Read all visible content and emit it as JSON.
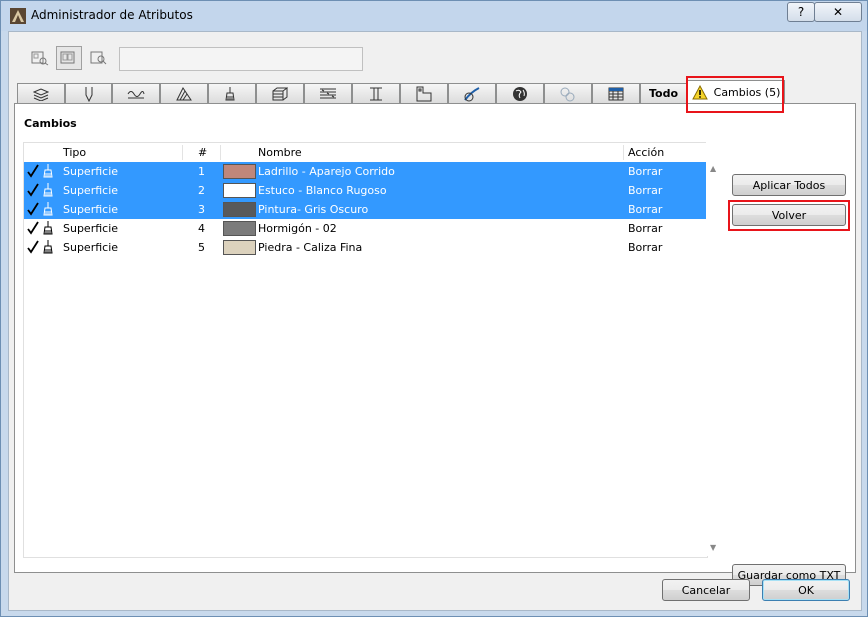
{
  "window": {
    "title": "Administrador de Atributos",
    "help_label": "?",
    "close_label": "✕"
  },
  "toolbar": {
    "search_placeholder": ""
  },
  "tabs": [
    {
      "icon": "layers-icon"
    },
    {
      "icon": "pen-icon"
    },
    {
      "icon": "line-type-icon"
    },
    {
      "icon": "fill-icon"
    },
    {
      "icon": "brush-icon"
    },
    {
      "icon": "composite-icon"
    },
    {
      "icon": "profile-lines-icon"
    },
    {
      "icon": "i-beam-icon"
    },
    {
      "icon": "zone-icon"
    },
    {
      "icon": "surface-icon"
    },
    {
      "icon": "globe-icon"
    },
    {
      "icon": "mep-icon"
    },
    {
      "icon": "grid-icon"
    },
    {
      "label": "Todo"
    },
    {
      "label": "Cambios (5)",
      "icon": "warning-icon"
    }
  ],
  "panel": {
    "title": "Cambios",
    "columns": {
      "tipo": "Tipo",
      "num": "#",
      "nombre": "Nombre",
      "accion": "Acción"
    },
    "rows": [
      {
        "tipo": "Superficie",
        "num": "1",
        "nombre": "Ladrillo - Aparejo Corrido",
        "accion": "Borrar",
        "color": "#c0877a",
        "selected": true
      },
      {
        "tipo": "Superficie",
        "num": "2",
        "nombre": "Estuco - Blanco Rugoso",
        "accion": "Borrar",
        "color": "#ffffff",
        "selected": true
      },
      {
        "tipo": "Superficie",
        "num": "3",
        "nombre": "Pintura- Gris Oscuro",
        "accion": "Borrar",
        "color": "#58595b",
        "selected": true
      },
      {
        "tipo": "Superficie",
        "num": "4",
        "nombre": "Hormigón - 02",
        "accion": "Borrar",
        "color": "#7b7b7b",
        "selected": false
      },
      {
        "tipo": "Superficie",
        "num": "5",
        "nombre": "Piedra - Caliza Fina",
        "accion": "Borrar",
        "color": "#dcd2bd",
        "selected": false
      }
    ]
  },
  "buttons": {
    "apply_all": "Aplicar Todos",
    "revert": "Volver",
    "save_txt": "Guardar como TXT",
    "cancel": "Cancelar",
    "ok": "OK"
  },
  "colors": {
    "selection": "#3399ff",
    "highlight": "#e8141a"
  }
}
